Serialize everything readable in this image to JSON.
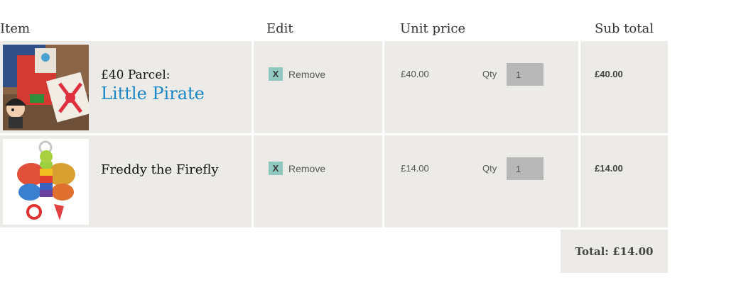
{
  "headers": {
    "item": "Item",
    "edit": "Edit",
    "unit_price": "Unit price",
    "sub_total": "Sub total"
  },
  "items": [
    {
      "name_line1": "£40 Parcel:",
      "name_line2": "Little Pirate",
      "remove_icon": "X",
      "remove_label": "Remove",
      "unit_price": "£40.00",
      "qty_label": "Qty",
      "qty_value": "1",
      "subtotal": "£40.00",
      "image": "little-pirate-parcel-photo"
    },
    {
      "name": "Freddy the Firefly",
      "remove_icon": "X",
      "remove_label": "Remove",
      "unit_price": "£14.00",
      "qty_label": "Qty",
      "qty_value": "1",
      "subtotal": "£14.00",
      "image": "freddy-firefly-toy-photo"
    }
  ],
  "total": "Total: £14.00",
  "colors": {
    "row_bg": "#ecebe7",
    "remove_icon_bg": "#8fc8bf",
    "link_blue": "#1a86c4",
    "qty_bg": "#b8b8b8"
  }
}
